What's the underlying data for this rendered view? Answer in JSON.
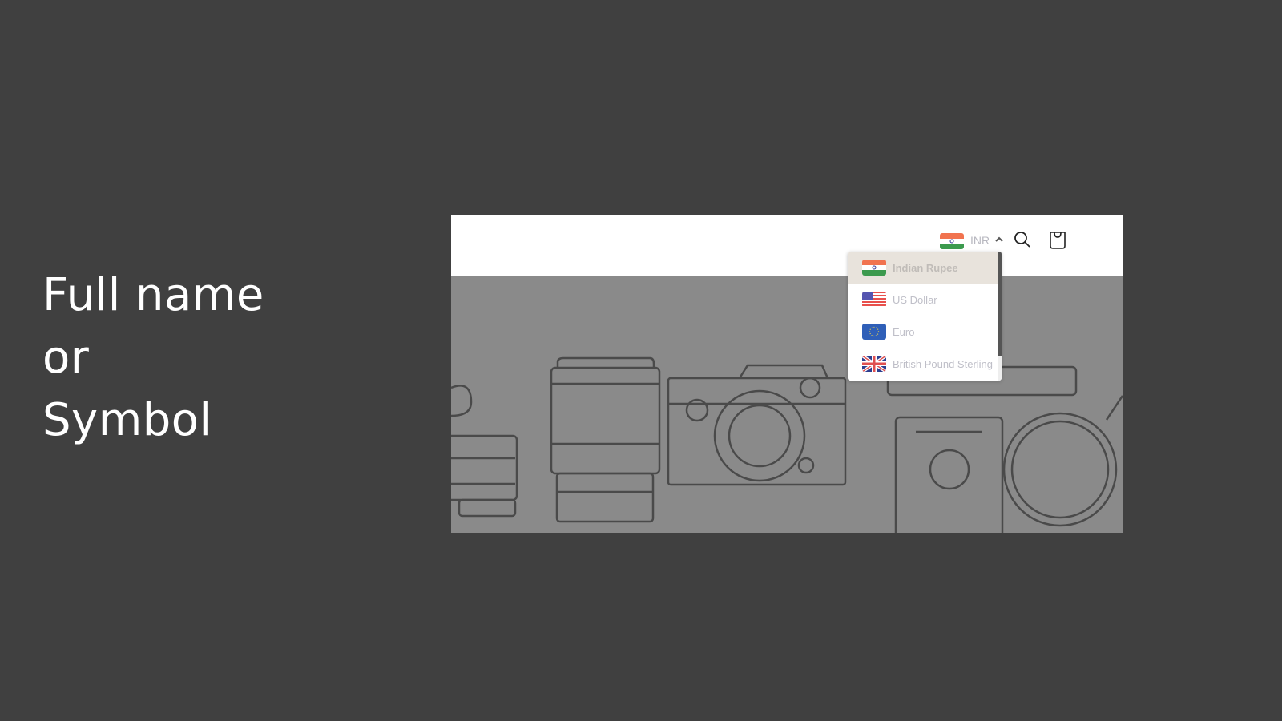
{
  "caption": {
    "line1": "Full name",
    "line2": "or",
    "line3": "Symbol"
  },
  "header": {
    "current_currency_code": "INR",
    "current_currency_flag": "india-flag",
    "search_icon": "search-icon",
    "cart_icon": "cart-icon",
    "dropdown_state": "open"
  },
  "currency_dropdown": {
    "items": [
      {
        "label": "Indian Rupee",
        "flag": "india-flag",
        "selected": true
      },
      {
        "label": "US Dollar",
        "flag": "us-flag",
        "selected": false
      },
      {
        "label": "Euro",
        "flag": "eu-flag",
        "selected": false
      },
      {
        "label": "British Pound Sterling",
        "flag": "uk-flag",
        "selected": false
      }
    ]
  },
  "banner": {
    "illustration": "travel-line-art: lenses, camera, passport, magnifying glass"
  },
  "colors": {
    "slide_background": "#404040",
    "banner_gray": "#8a8a8a",
    "selected_item_bg": "#e8e3dc",
    "label_text": "#bfbfc8"
  }
}
